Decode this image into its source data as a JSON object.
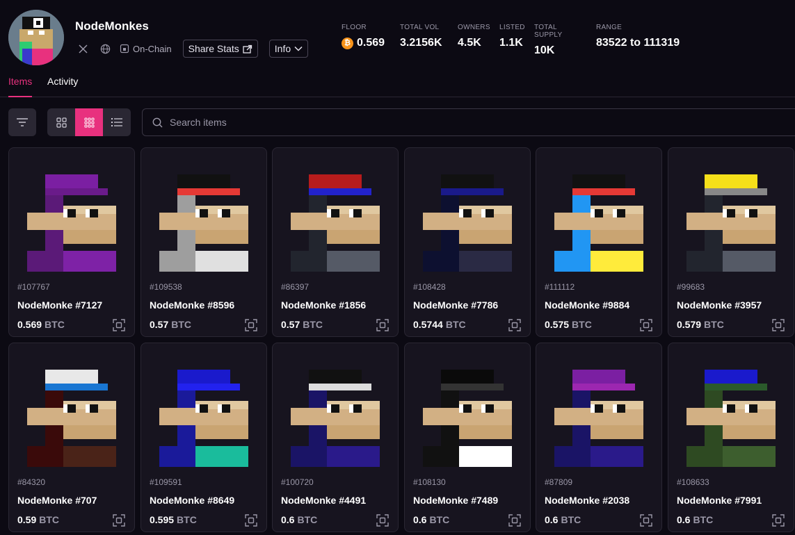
{
  "collection": {
    "name": "NodeMonkes",
    "social": {
      "x_icon": "x-twitter-icon",
      "web_icon": "globe-icon",
      "onchain_label": "On-Chain"
    },
    "share_label": "Share Stats",
    "info_label": "Info"
  },
  "stats": [
    {
      "label": "FLOOR",
      "value": "0.569",
      "icon": "bitcoin-icon"
    },
    {
      "label": "TOTAL VOL",
      "value": "3.2156K"
    },
    {
      "label": "OWNERS",
      "value": "4.5K"
    },
    {
      "label": "LISTED",
      "value": "1.1K"
    },
    {
      "label": "TOTAL SUPPLY",
      "value": "10K"
    },
    {
      "label": "RANGE",
      "value": "83522 to 111319"
    }
  ],
  "tabs": [
    {
      "label": "Items",
      "active": true
    },
    {
      "label": "Activity",
      "active": false
    }
  ],
  "search": {
    "placeholder": "Search items"
  },
  "colors": {
    "accent": "#e8317e",
    "bitcoin": "#f7931a",
    "background": "#0c0a13",
    "card": "#17141f"
  },
  "items": [
    {
      "inscription": "#107767",
      "name": "NodeMonke #7127",
      "price": "0.569",
      "currency": "BTC",
      "palette": {
        "hat": "#7b1fa2",
        "hat2": "#6a1b8a",
        "body": "#5b1a78",
        "body2": "#7e22a6"
      }
    },
    {
      "inscription": "#109538",
      "name": "NodeMonke #8596",
      "price": "0.57",
      "currency": "BTC",
      "palette": {
        "hat": "#111111",
        "hat2": "#e53935",
        "body": "#9e9e9e",
        "body2": "#e0e0e0"
      }
    },
    {
      "inscription": "#86397",
      "name": "NodeMonke #1856",
      "price": "0.57",
      "currency": "BTC",
      "palette": {
        "hat": "#b71c1c",
        "hat2": "#2222cc",
        "body": "#22252e",
        "body2": "#555a66"
      }
    },
    {
      "inscription": "#108428",
      "name": "NodeMonke #7786",
      "price": "0.5744",
      "currency": "BTC",
      "palette": {
        "hat": "#111111",
        "hat2": "#1a1a8a",
        "body": "#0d1030",
        "body2": "#2a2a44"
      }
    },
    {
      "inscription": "#111112",
      "name": "NodeMonke #9884",
      "price": "0.575",
      "currency": "BTC",
      "palette": {
        "hat": "#111111",
        "hat2": "#e53935",
        "body": "#2196f3",
        "body2": "#ffeb3b"
      }
    },
    {
      "inscription": "#99683",
      "name": "NodeMonke #3957",
      "price": "0.579",
      "currency": "BTC",
      "palette": {
        "hat": "#f5e01a",
        "hat2": "#888888",
        "body": "#22252e",
        "body2": "#555a66"
      }
    },
    {
      "inscription": "#84320",
      "name": "NodeMonke #707",
      "price": "0.59",
      "currency": "BTC",
      "palette": {
        "hat": "#e8e8e8",
        "hat2": "#1976d2",
        "body": "#3a0a0a",
        "body2": "#4a2318"
      }
    },
    {
      "inscription": "#109591",
      "name": "NodeMonke #8649",
      "price": "0.595",
      "currency": "BTC",
      "palette": {
        "hat": "#1a1acc",
        "hat2": "#2222ee",
        "body": "#1a1a9a",
        "body2": "#1abc9c"
      }
    },
    {
      "inscription": "#100720",
      "name": "NodeMonke #4491",
      "price": "0.6",
      "currency": "BTC",
      "palette": {
        "hat": "#111111",
        "hat2": "#dddddd",
        "body": "#1a1466",
        "body2": "#2a1a8a"
      }
    },
    {
      "inscription": "#108130",
      "name": "NodeMonke #7489",
      "price": "0.6",
      "currency": "BTC",
      "palette": {
        "hat": "#0a0a0a",
        "hat2": "#333333",
        "body": "#111111",
        "body2": "#ffffff"
      }
    },
    {
      "inscription": "#87809",
      "name": "NodeMonke #2038",
      "price": "0.6",
      "currency": "BTC",
      "palette": {
        "hat": "#7b1fa2",
        "hat2": "#9c27b0",
        "body": "#1a1466",
        "body2": "#2a1a8a"
      }
    },
    {
      "inscription": "#108633",
      "name": "NodeMonke #7991",
      "price": "0.6",
      "currency": "BTC",
      "palette": {
        "hat": "#1a1acc",
        "hat2": "#2b5a2b",
        "body": "#2e4a22",
        "body2": "#3d5e2e"
      }
    }
  ]
}
